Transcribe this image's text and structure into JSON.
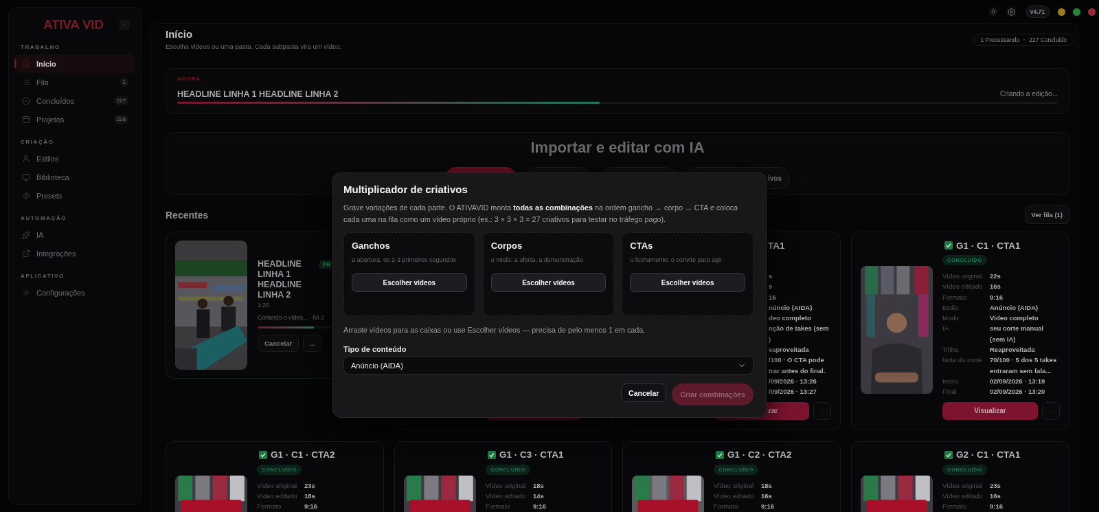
{
  "sidebar": {
    "brand": "ATIVA VID",
    "sections": [
      {
        "title": "TRABALHO",
        "items": [
          {
            "label": "Início",
            "selected": true
          },
          {
            "label": "Fila",
            "badge": "1",
            "selected": false
          },
          {
            "label": "Concluídos",
            "badge": "227",
            "selected": false
          },
          {
            "label": "Projetos",
            "badge": "228",
            "selected": false
          }
        ]
      },
      {
        "title": "CRIAÇÃO",
        "items": [
          {
            "label": "Estilos",
            "selected": false
          },
          {
            "label": "Biblioteca",
            "selected": false
          },
          {
            "label": "Presets",
            "selected": false
          }
        ]
      },
      {
        "title": "AUTOMAÇÃO",
        "items": [
          {
            "label": "IA",
            "selected": false
          },
          {
            "label": "Integrações",
            "selected": false
          }
        ]
      },
      {
        "title": "APLICATIVO",
        "items": [
          {
            "label": "Configurações",
            "selected": false
          }
        ]
      }
    ]
  },
  "top_bar": {
    "version": "v4.71"
  },
  "header": {
    "title": "Início",
    "subtitle": "Escolha vídeos ou uma pasta. Cada subpasta vira um vídeo.",
    "status": [
      "1 Processando",
      "227 Concluído"
    ]
  },
  "now": {
    "label": "AGORA",
    "title": "HEADLINE LINHA 1 HEADLINE LINHA 2",
    "status": "Criando a edição...",
    "level": 0.48
  },
  "import": {
    "title": "Importar e editar com IA",
    "tabs": [
      {
        "selected": true
      },
      {
        "selected": false
      },
      {
        "selected": false
      },
      {
        "label": "ivos",
        "selected": false
      }
    ]
  },
  "recent": {
    "title": "Recentes",
    "queue_button": "Ver fila (1)",
    "cards": [
      {
        "kind": "processing",
        "headline": "HEADLINE LINHA 1 HEADLINE LINHA 2",
        "badge": "PR",
        "duration": "1:20",
        "status": "Cortando o vídeo... · há 2",
        "level": 0.48,
        "buttons": [
          "Cancelar",
          "..."
        ]
      },
      {
        "kind": "covered"
      },
      {
        "kind": "partial",
        "title": "TA1",
        "lines": [
          "s",
          "s",
          "16",
          "núncio (AIDA)",
          "deo completo",
          "nção de takes (sem",
          ")",
          "eaproveitada",
          "/100 · O CTA pode",
          "trar antes do final.",
          "/09/2026 · 13:26",
          "/09/2026 · 13:27"
        ],
        "button": "zar",
        "more": "..."
      },
      {
        "kind": "done",
        "title": "G1 · C1 · CTA1",
        "badge": "CONCLUÍDO",
        "rows": [
          {
            "label": "Vídeo original",
            "value": "22s"
          },
          {
            "label": "Vídeo editado",
            "value": "16s"
          },
          {
            "label": "Formato",
            "value": "9:16"
          },
          {
            "label": "Estilo",
            "value": "Anúncio (AIDA)"
          },
          {
            "label": "Modo",
            "value": "Vídeo completo"
          },
          {
            "label": "IA",
            "value": "seu corte manual (sem IA)"
          },
          {
            "label": "Trilha",
            "value": "Reaproveitada"
          },
          {
            "label": "Nota do corte",
            "value": "70/100 · 5 dos 5 takes entraram sem fala..."
          },
          {
            "label": "Início",
            "value": "02/09/2026 · 13:19"
          },
          {
            "label": "Final",
            "value": "02/09/2026 · 13:20"
          }
        ],
        "button": "Visualizar",
        "more": "..."
      },
      {
        "kind": "done",
        "title": "G1 · C1 · CTA2",
        "badge": "CONCLUÍDO",
        "rows": [
          {
            "label": "Vídeo original",
            "value": "23s"
          },
          {
            "label": "Vídeo editado",
            "value": "18s"
          },
          {
            "label": "Formato",
            "value": "9:16"
          }
        ]
      },
      {
        "kind": "done",
        "title": "G1 · C3 · CTA1",
        "badge": "CONCLUÍDO",
        "rows": [
          {
            "label": "Vídeo original",
            "value": "18s"
          },
          {
            "label": "Vídeo editado",
            "value": "14s"
          },
          {
            "label": "Formato",
            "value": "9:16"
          }
        ]
      },
      {
        "kind": "done",
        "title": "G1 · C2 · CTA2",
        "badge": "CONCLUÍDO",
        "rows": [
          {
            "label": "Vídeo original",
            "value": "18s"
          },
          {
            "label": "Vídeo editado",
            "value": "16s"
          },
          {
            "label": "Formato",
            "value": "9:16"
          }
        ]
      },
      {
        "kind": "done",
        "title": "G2 · C1 · CTA1",
        "badge": "CONCLUÍDO",
        "rows": [
          {
            "label": "Vídeo original",
            "value": "23s"
          },
          {
            "label": "Vídeo editado",
            "value": "16s"
          },
          {
            "label": "Formato",
            "value": "9:16"
          }
        ]
      }
    ]
  },
  "modal": {
    "title": "Multiplicador de criativos",
    "intro": "Grave variações de cada parte. O ATIVAVID monta **todas as combinações** na ordem gancho → corpo → CTA e coloca cada uma na fila como um vídeo próprio (ex.: 3 × 3 × 3 = 27 criativos para testar no tráfego pago).",
    "slots": [
      {
        "title": "Ganchos",
        "hint": "a abertura, os 2-3 primeiros segundos",
        "button": "Escolher vídeos"
      },
      {
        "title": "Corpos",
        "hint": "o miolo: a oferta, a demonstração",
        "button": "Escolher vídeos"
      },
      {
        "title": "CTAs",
        "hint": "o fechamento: o convite para agir",
        "button": "Escolher vídeos"
      }
    ],
    "note": "Arraste vídeos para as caixas ou use Escolher vídeos — precisa de pelo menos 1 em cada.",
    "field_label": "Tipo de conteúdo",
    "select_value": "Anúncio (AIDA)",
    "cancel": "Cancelar",
    "confirm": {
      "label": "Criar combinações",
      "disabled": true
    }
  }
}
